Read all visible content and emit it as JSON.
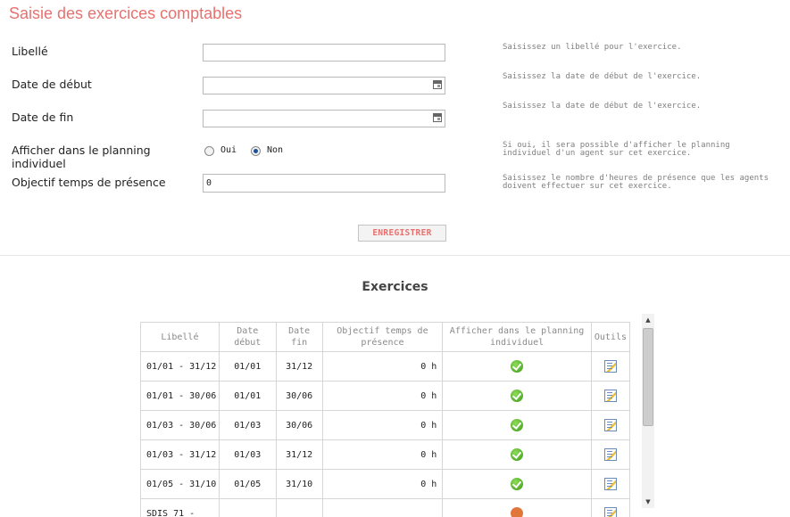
{
  "title": "Saisie des exercices comptables",
  "form": {
    "libelle_label": "Libellé",
    "libelle_value": "",
    "libelle_help": "Saisissez un libellé pour l'exercice.",
    "date_debut_label": "Date de début",
    "date_debut_help": "Saisissez la date de début de l'exercice.",
    "date_fin_label": "Date de fin",
    "date_fin_help": "Saisissez la date de début de l'exercice.",
    "planning_label": "Afficher dans le planning individuel",
    "planning_oui": "Oui",
    "planning_non": "Non",
    "planning_selected": "Non",
    "planning_help": "Si oui, il sera possible d'afficher le planning individuel d'un agent sur cet exercice.",
    "objectif_label": "Objectif temps de présence",
    "objectif_value": "0",
    "objectif_help": "Saisissez le nombre d'heures de présence que les agents doivent effectuer sur cet exercice.",
    "save_label": "ENREGISTRER"
  },
  "section_title": "Exercices",
  "table": {
    "headers": [
      "Libellé",
      "Date début",
      "Date fin",
      "Objectif temps de présence",
      "Afficher dans le planning individuel",
      "Outils"
    ],
    "rows": [
      {
        "libelle": "01/01 - 31/12",
        "debut": "01/01",
        "fin": "31/12",
        "objectif": "0 h",
        "planning": "ok",
        "outil": "edit-icon"
      },
      {
        "libelle": "01/01 - 30/06",
        "debut": "01/01",
        "fin": "30/06",
        "objectif": "0 h",
        "planning": "ok",
        "outil": "edit-icon"
      },
      {
        "libelle": "01/03 - 30/06",
        "debut": "01/03",
        "fin": "30/06",
        "objectif": "0 h",
        "planning": "ok",
        "outil": "edit-icon"
      },
      {
        "libelle": "01/03 - 31/12",
        "debut": "01/03",
        "fin": "31/12",
        "objectif": "0 h",
        "planning": "ok",
        "outil": "edit-icon"
      },
      {
        "libelle": "01/05 - 31/10",
        "debut": "01/05",
        "fin": "31/10",
        "objectif": "0 h",
        "planning": "ok",
        "outil": "edit-icon"
      },
      {
        "libelle": "SDIS 71 -",
        "debut": "",
        "fin": "",
        "objectif": "",
        "planning": "warn",
        "outil": "edit-icon"
      }
    ]
  },
  "colors": {
    "accent": "#e8716f",
    "help_text": "#7f7f7f"
  }
}
